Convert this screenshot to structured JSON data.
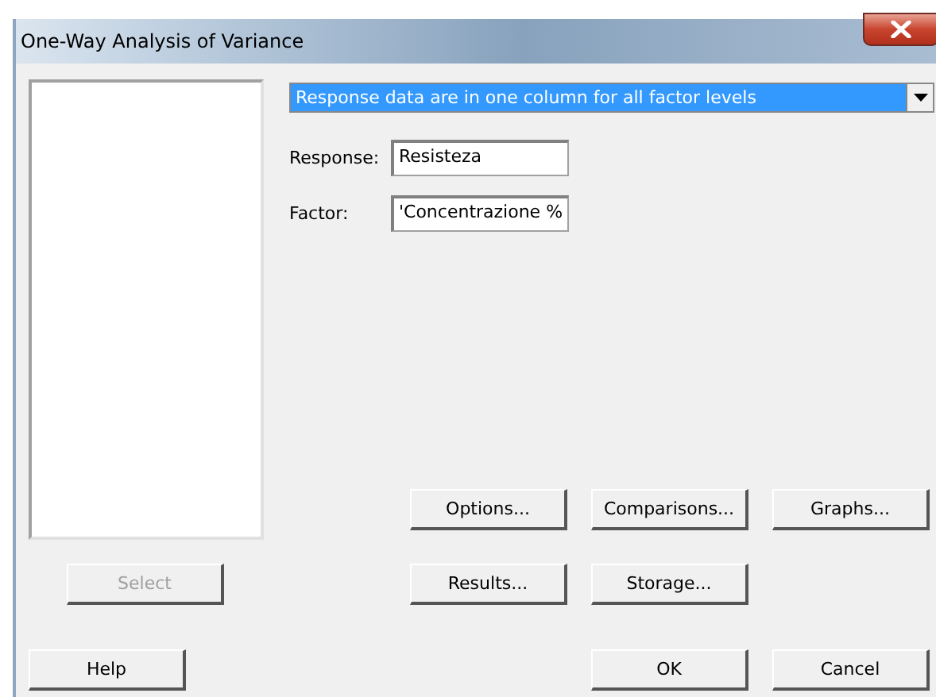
{
  "window": {
    "title": "One-Way Analysis of Variance"
  },
  "layout_dropdown": {
    "value": "Response data are in one column for all factor levels",
    "selected": true
  },
  "fields": [
    {
      "label": "Response:",
      "value": "Resisteza"
    },
    {
      "label": "Factor:",
      "value": "'Concentrazione %"
    }
  ],
  "option_buttons": [
    {
      "label": "Options...",
      "disabled": false
    },
    {
      "label": "Comparisons...",
      "disabled": false
    },
    {
      "label": "Graphs...",
      "disabled": false
    }
  ],
  "select_button": {
    "label": "Select",
    "disabled": true
  },
  "output_buttons": [
    {
      "label": "Results...",
      "disabled": false
    },
    {
      "label": "Storage...",
      "disabled": false
    }
  ],
  "footer_buttons": [
    {
      "label": "Help",
      "disabled": false
    },
    {
      "label": "OK",
      "disabled": false
    },
    {
      "label": "Cancel",
      "disabled": false
    }
  ]
}
